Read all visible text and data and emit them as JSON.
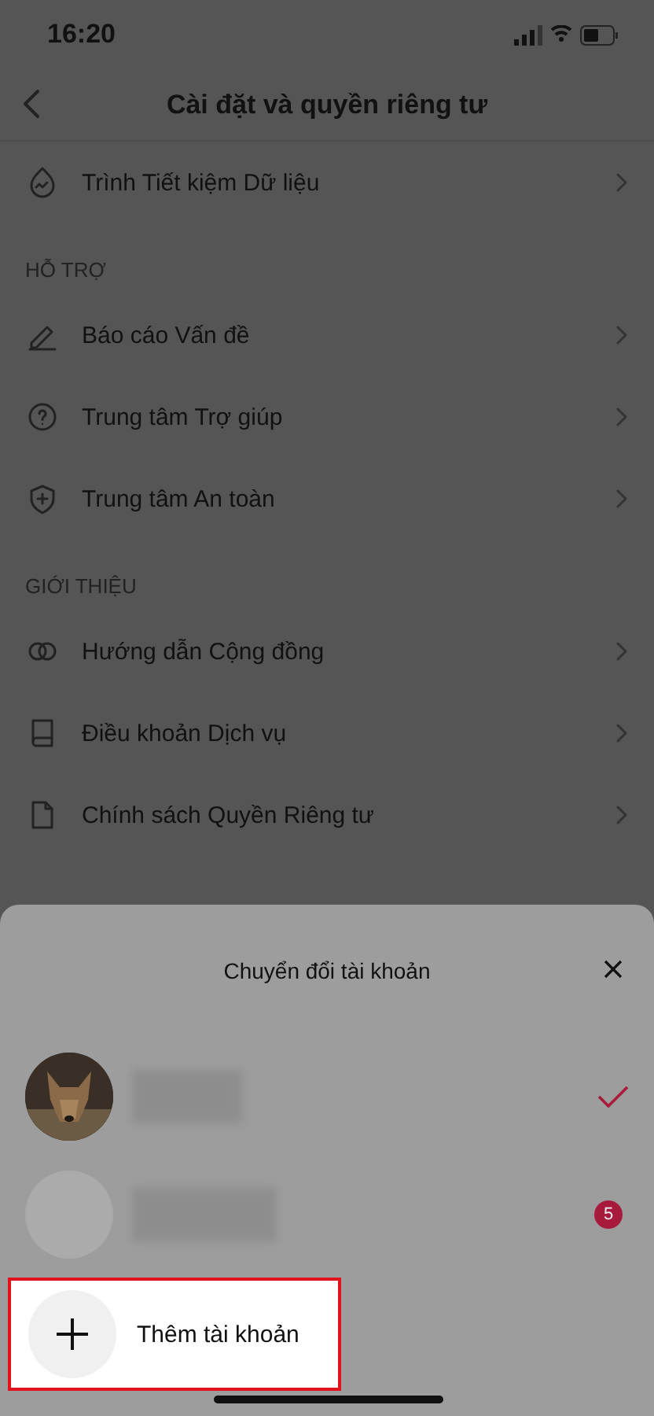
{
  "status_bar": {
    "time": "16:20"
  },
  "header": {
    "title": "Cài đặt và quyền riêng tư"
  },
  "sections": [
    {
      "items": [
        {
          "label": "Trình Tiết kiệm Dữ liệu"
        }
      ]
    },
    {
      "heading": "HỖ TRỢ",
      "items": [
        {
          "label": "Báo cáo Vấn đề"
        },
        {
          "label": "Trung tâm Trợ giúp"
        },
        {
          "label": "Trung tâm An toàn"
        }
      ]
    },
    {
      "heading": "GIỚI THIỆU",
      "items": [
        {
          "label": "Hướng dẫn Cộng đồng"
        },
        {
          "label": "Điều khoản Dịch vụ"
        },
        {
          "label": "Chính sách Quyền Riêng tư"
        }
      ]
    }
  ],
  "sheet": {
    "title": "Chuyển đổi tài khoản",
    "accounts": [
      {
        "kind": "picture",
        "selected": true
      },
      {
        "kind": "plain",
        "selected": false,
        "badge": "5"
      }
    ],
    "add_account": {
      "label": "Thêm tài khoản",
      "highlighted": true
    }
  }
}
